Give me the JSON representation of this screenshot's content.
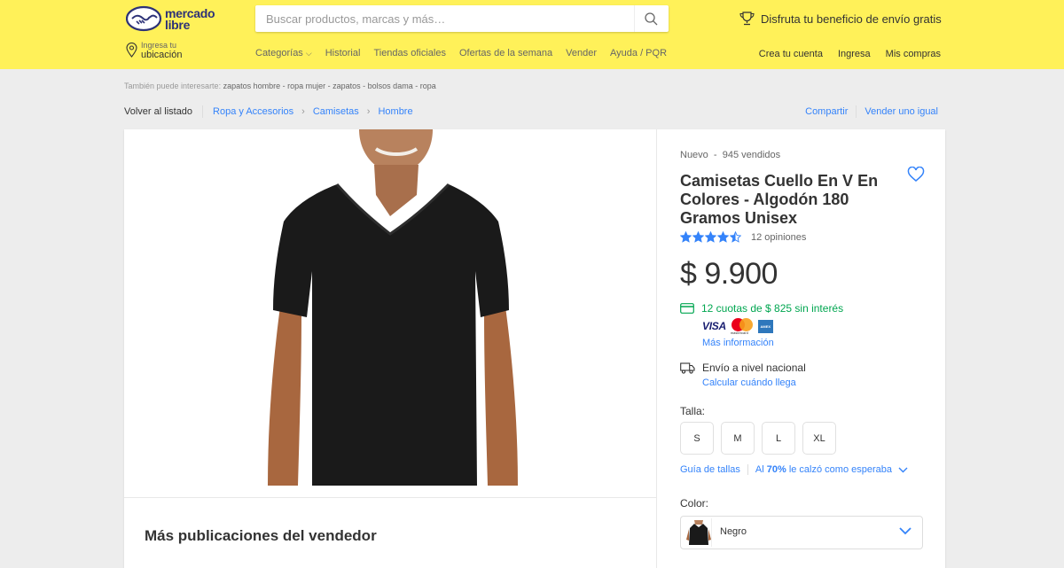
{
  "header": {
    "logo_line1": "mercado",
    "logo_line2": "libre",
    "search_placeholder": "Buscar productos, marcas y más…",
    "promo": "Disfruta tu beneficio de envío gratis",
    "location_line1": "Ingresa tu",
    "location_line2": "ubicación",
    "nav": [
      "Categorías",
      "Historial",
      "Tiendas oficiales",
      "Ofertas de la semana",
      "Vender",
      "Ayuda / PQR"
    ],
    "account": [
      "Crea tu cuenta",
      "Ingresa",
      "Mis compras"
    ],
    "brand_color": "#fff159"
  },
  "related": {
    "prefix": "También puede interesarte:",
    "terms": "zapatos hombre - ropa mujer - zapatos - bolsos dama - ropa"
  },
  "breadcrumb": {
    "back": "Volver al listado",
    "items": [
      "Ropa y Accesorios",
      "Camisetas",
      "Hombre"
    ],
    "share": "Compartir",
    "sell_same": "Vender uno igual"
  },
  "product": {
    "condition": "Nuevo",
    "sold": "945 vendidos",
    "title": "Camisetas Cuello En V En Colores - Algodón 180 Gramos Unisex",
    "rating": 4.5,
    "reviews": "12 opiniones",
    "price": "$ 9.900",
    "installments": "12 cuotas de $ 825 sin interés",
    "payment_cards": [
      "VISA",
      "mastercard",
      "AMEX"
    ],
    "more_info": "Más información",
    "shipping": "Envío a nivel nacional",
    "shipping_link": "Calcular cuándo llega",
    "size_label": "Talla:",
    "sizes": [
      "S",
      "M",
      "L",
      "XL"
    ],
    "size_guide": "Guía de tallas",
    "fit_prefix": "Al",
    "fit_pct": "70%",
    "fit_suffix": "le calzó como esperaba",
    "color_label": "Color:",
    "color_value": "Negro"
  },
  "seller": {
    "more_title": "Más publicaciones del vendedor"
  },
  "colors": {
    "link": "#3483fa",
    "success": "#00a650",
    "star": "#3483fa"
  }
}
